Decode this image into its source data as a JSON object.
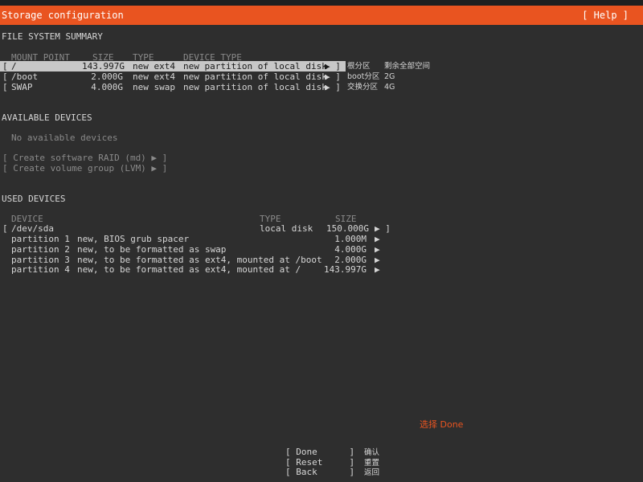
{
  "header": {
    "title": "Storage configuration",
    "help": "[ Help ]"
  },
  "fs_summary": {
    "heading": "FILE SYSTEM SUMMARY",
    "columns": {
      "mount": "MOUNT POINT",
      "size": "SIZE",
      "type": "TYPE",
      "device_type": "DEVICE TYPE"
    },
    "rows": [
      {
        "open": "[",
        "mount": "/",
        "size": "143.997G",
        "type": "new ext4",
        "device_type": "new partition of local disk",
        "arrow": "▶ ]",
        "note1": "根分区",
        "note2": "剩余全部空间"
      },
      {
        "open": "[",
        "mount": "/boot",
        "size": "2.000G",
        "type": "new ext4",
        "device_type": "new partition of local disk",
        "arrow": "▶ ]",
        "note1": "boot分区",
        "note2": "2G"
      },
      {
        "open": "[",
        "mount": "SWAP",
        "size": "4.000G",
        "type": "new swap",
        "device_type": "new partition of local disk",
        "arrow": "▶ ]",
        "note1": "交换分区",
        "note2": "4G"
      }
    ]
  },
  "available": {
    "heading": "AVAILABLE DEVICES",
    "empty": "No available devices",
    "raid": "[ Create software RAID (md) ▶ ]",
    "lvm": "[ Create volume group (LVM) ▶ ]"
  },
  "used": {
    "heading": "USED DEVICES",
    "columns": {
      "device": "DEVICE",
      "type": "TYPE",
      "size": "SIZE"
    },
    "disk": {
      "open": "[",
      "name": "/dev/sda",
      "type": "local disk",
      "size": "150.000G",
      "arrow": "▶ ]"
    },
    "partitions": [
      {
        "name": "partition 1",
        "desc": "new, BIOS grub spacer",
        "size": "1.000M",
        "arrow": "▶"
      },
      {
        "name": "partition 2",
        "desc": "new, to be formatted as swap",
        "size": "4.000G",
        "arrow": "▶"
      },
      {
        "name": "partition 3",
        "desc": "new, to be formatted as ext4, mounted at /boot",
        "size": "2.000G",
        "arrow": "▶"
      },
      {
        "name": "partition 4",
        "desc": "new, to be formatted as ext4, mounted at /",
        "size": "143.997G",
        "arrow": "▶"
      }
    ]
  },
  "annotation": {
    "select_done": "选择  Done"
  },
  "buttons": [
    {
      "label": "[ Done      ]",
      "note": "确认"
    },
    {
      "label": "[ Reset     ]",
      "note": "重置"
    },
    {
      "label": "[ Back      ]",
      "note": "返回"
    }
  ],
  "colors": {
    "accent": "#e95420",
    "background": "#2e2e2e",
    "text": "#d6d6d6"
  }
}
